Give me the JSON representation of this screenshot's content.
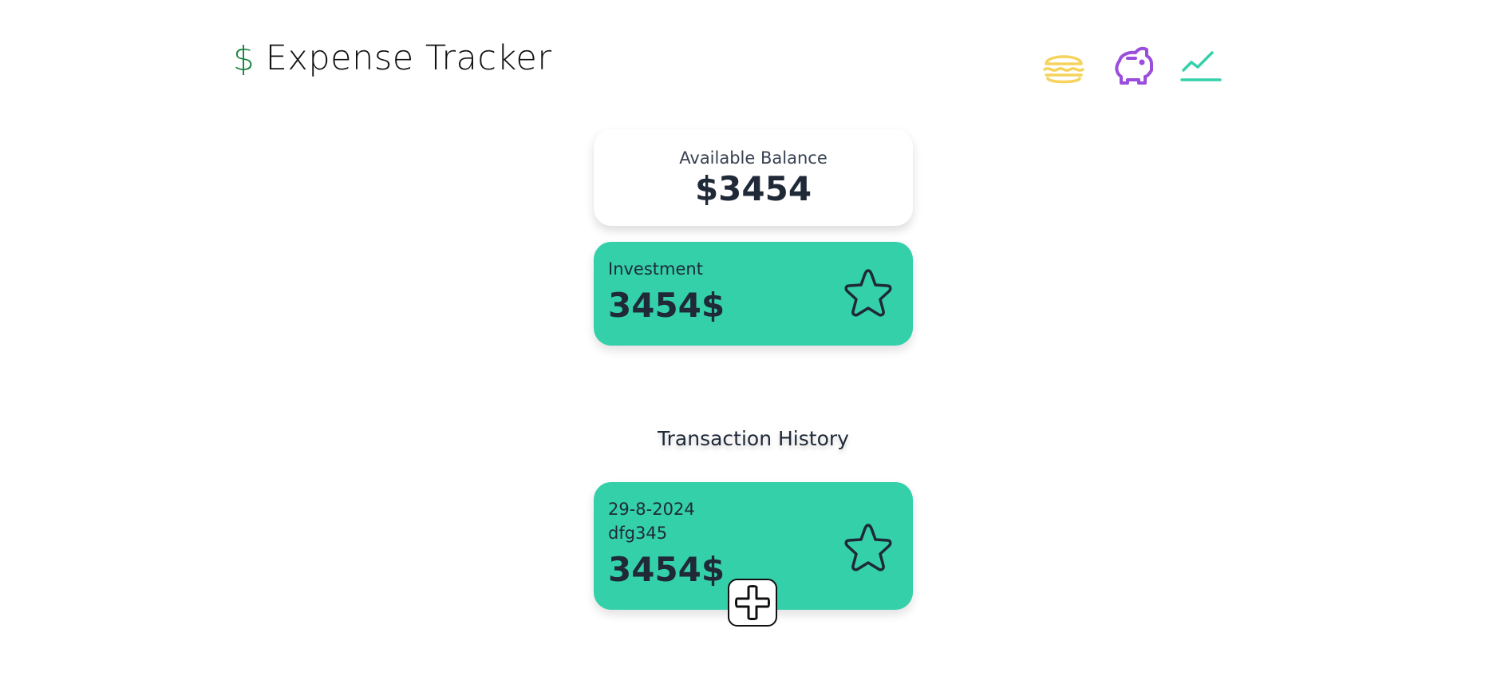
{
  "header": {
    "currency_symbol": "$",
    "title": "Expense Tracker"
  },
  "nav": {
    "icons": [
      "burger-icon",
      "piggy-bank-icon",
      "trend-chart-icon"
    ],
    "colors": {
      "burger": "#f5d35c",
      "piggy": "#9b4ddb",
      "trend": "#34d0aa"
    }
  },
  "balance": {
    "label": "Available Balance",
    "amount": "$3454"
  },
  "investment": {
    "label": "Investment",
    "amount": "3454$"
  },
  "history": {
    "title": "Transaction History",
    "transactions": [
      {
        "date": "29-8-2024",
        "description": "dfg345",
        "amount": "3454$"
      }
    ]
  },
  "colors": {
    "accent_green": "#34d0aa",
    "dollar_green": "#15803d",
    "text_dark": "#1f2937"
  },
  "add_button": {
    "icon": "plus-icon"
  }
}
